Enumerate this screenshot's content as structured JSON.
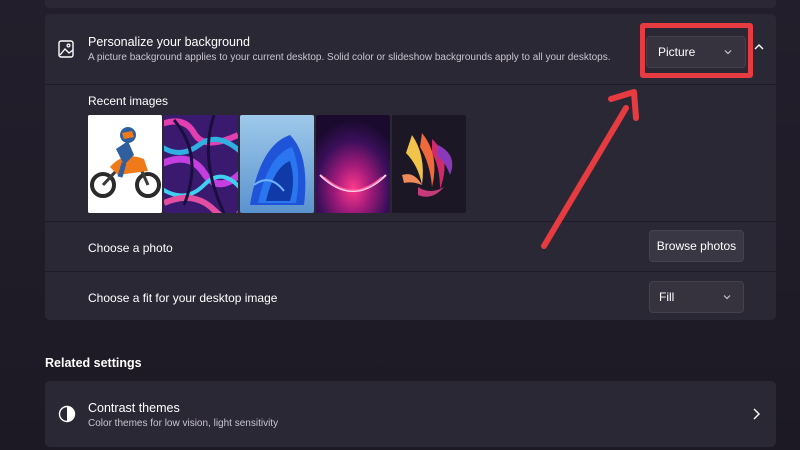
{
  "background_card": {
    "title": "Personalize your background",
    "description": "A picture background applies to your current desktop. Solid color or slideshow backgrounds apply to all your desktops.",
    "icon": "picture-frame-icon",
    "type_dropdown": {
      "selected": "Picture"
    }
  },
  "recent_images": {
    "label": "Recent images",
    "items": [
      {
        "name": "motorcycle-rider"
      },
      {
        "name": "purple-swirls"
      },
      {
        "name": "blue-bloom"
      },
      {
        "name": "purple-glow-arc"
      },
      {
        "name": "colorful-ribbons"
      }
    ]
  },
  "choose_photo": {
    "label": "Choose a photo",
    "button": "Browse photos"
  },
  "choose_fit": {
    "label": "Choose a fit for your desktop image",
    "selected": "Fill"
  },
  "related": {
    "heading": "Related settings",
    "contrast": {
      "title": "Contrast themes",
      "description": "Color themes for low vision, light sensitivity",
      "icon": "contrast-icon"
    }
  },
  "colors": {
    "page_bg": "#1d1a26",
    "card_bg": "#2b2835",
    "annotation_red": "#e63b40"
  }
}
